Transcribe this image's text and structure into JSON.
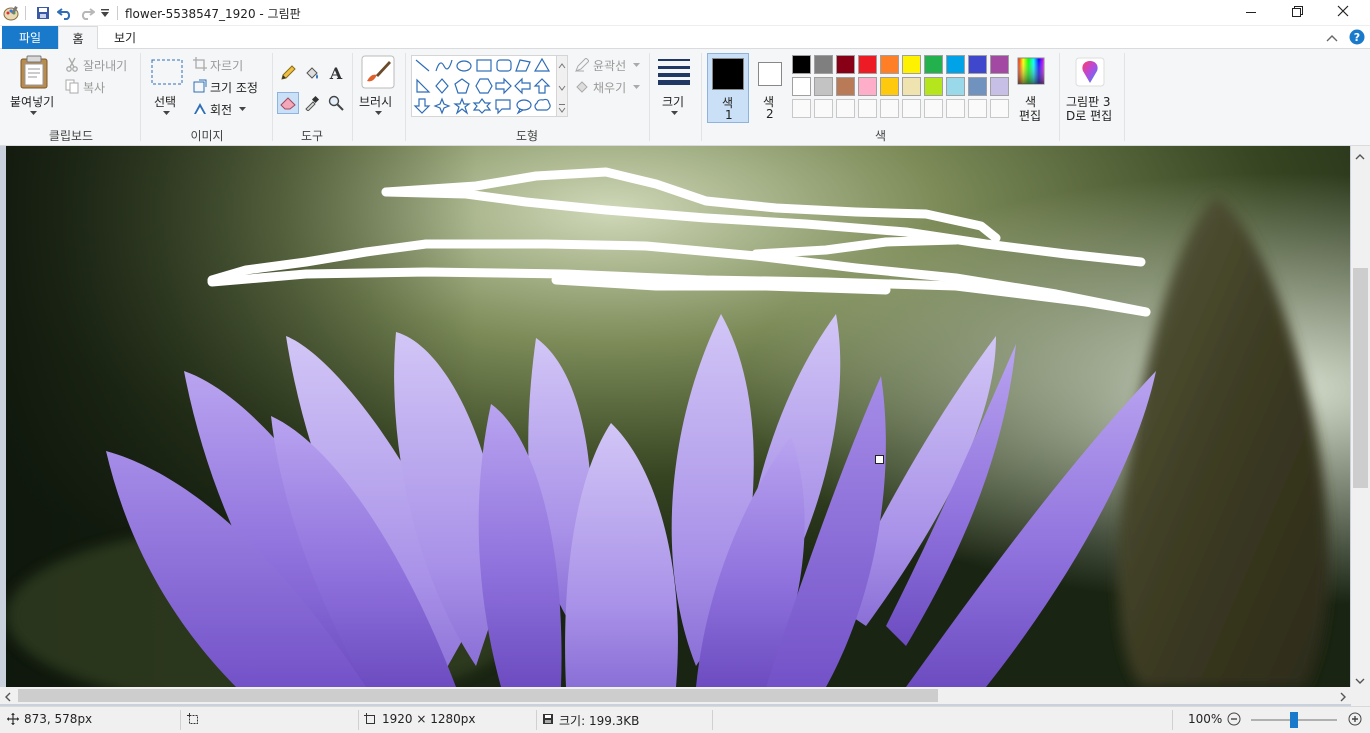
{
  "window": {
    "title": "flower-5538547_1920 - 그림판",
    "controls": [
      "minimize-icon",
      "restore-icon",
      "close-icon"
    ]
  },
  "tabs": {
    "file": "파일",
    "home": "홈",
    "view": "보기"
  },
  "ribbon": {
    "clipboard": {
      "paste": "붙여넣기",
      "cut": "잘라내기",
      "copy": "복사",
      "label": "클립보드"
    },
    "image": {
      "select": "선택",
      "crop": "자르기",
      "resize": "크기 조정",
      "rotate": "회전",
      "label": "이미지"
    },
    "tools": {
      "label": "도구"
    },
    "brush": {
      "label": "브러시"
    },
    "shapes": {
      "outline": "윤곽선",
      "fill": "채우기",
      "label": "도형"
    },
    "size": {
      "label": "크기"
    },
    "colors": {
      "color1_label": "색",
      "color1_num": "1",
      "color2_label": "색",
      "color2_num": "2",
      "edit_label_1": "색",
      "edit_label_2": "편집",
      "label": "색",
      "color1": "#000000",
      "color2": "#ffffff",
      "palette_row1": [
        "#000000",
        "#7f7f7f",
        "#880015",
        "#ed1c24",
        "#ff7f27",
        "#fff200",
        "#22b14c",
        "#00a2e8",
        "#3f48cc",
        "#a349a4"
      ],
      "palette_row2": [
        "#ffffff",
        "#c3c3c3",
        "#b97a57",
        "#ffaec9",
        "#ffc90e",
        "#efe4b0",
        "#b5e61d",
        "#99d9ea",
        "#7092be",
        "#c8bfe7"
      ]
    },
    "paint3d": {
      "label_1": "그림판 3",
      "label_2": "D로 편집"
    }
  },
  "status": {
    "cursor_pos": "873, 578px",
    "image_size": "1920 × 1280px",
    "file_size": "크기: 199.3KB",
    "zoom": "100%",
    "zoom_level_percent": 100
  }
}
